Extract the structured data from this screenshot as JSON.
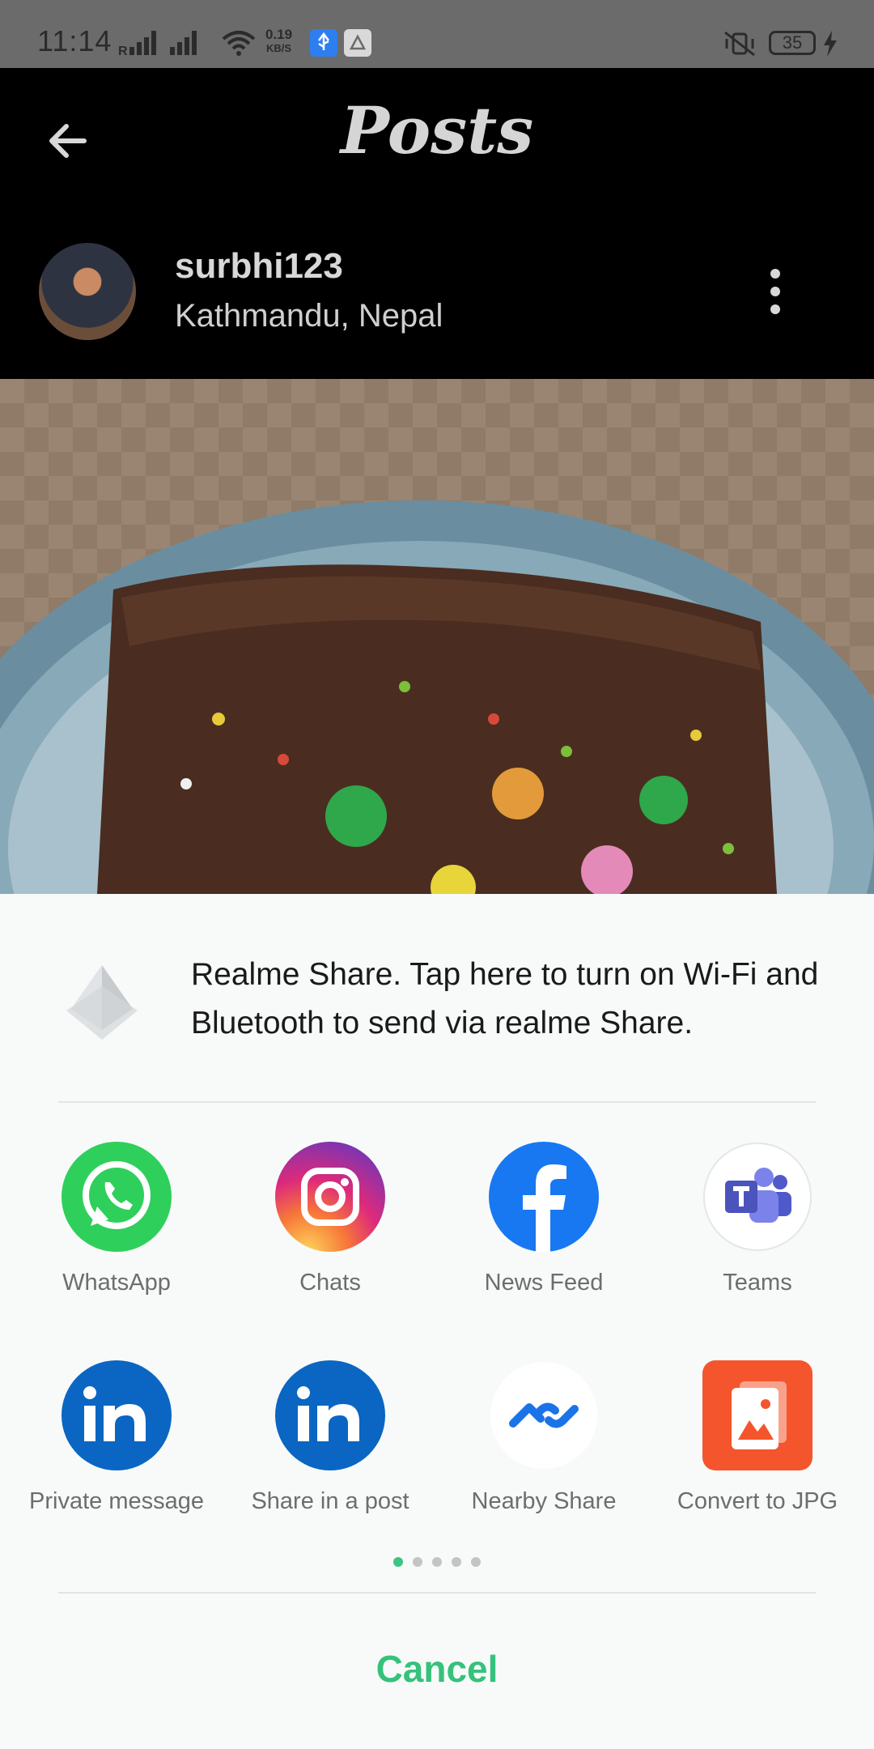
{
  "status_bar": {
    "time": "11:14",
    "net_speed": "0.19",
    "net_unit": "KB/S",
    "battery": "35"
  },
  "header": {
    "title": "Posts",
    "username": "surbhi123",
    "location": "Kathmandu, Nepal"
  },
  "share_sheet": {
    "realme_share_text": "Realme Share. Tap here to turn on Wi-Fi and Bluetooth to send via realme Share.",
    "apps": [
      {
        "label": "WhatsApp",
        "icon": "whatsapp-icon",
        "color": "#2fcf5c"
      },
      {
        "label": "Chats",
        "icon": "instagram-icon",
        "color": "#dd2a7b"
      },
      {
        "label": "News Feed",
        "icon": "facebook-icon",
        "color": "#1778f2"
      },
      {
        "label": "Teams",
        "icon": "teams-icon",
        "color": "#5059c9"
      },
      {
        "label": "Private message",
        "icon": "linkedin-icon",
        "color": "#0a66c2"
      },
      {
        "label": "Share in a post",
        "icon": "linkedin-icon",
        "color": "#0a66c2"
      },
      {
        "label": "Nearby Share",
        "icon": "nearby-share-icon",
        "color": "#1a73e8"
      },
      {
        "label": "Convert to JPG",
        "icon": "convert-jpg-icon",
        "color": "#f4552c"
      }
    ],
    "page_indicator": {
      "pages": 5,
      "current": 1
    },
    "cancel_label": "Cancel"
  }
}
